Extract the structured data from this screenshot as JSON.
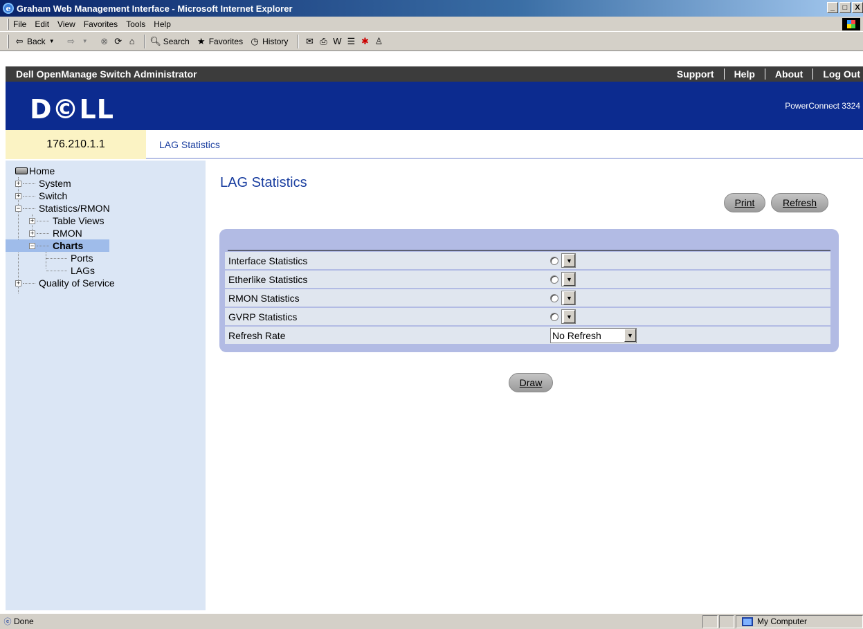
{
  "window": {
    "title": "Graham Web Management Interface - Microsoft Internet Explorer",
    "controls": [
      "_",
      "□",
      "X"
    ]
  },
  "menu": [
    "File",
    "Edit",
    "View",
    "Favorites",
    "Tools",
    "Help"
  ],
  "toolbar": {
    "back": "Back",
    "search": "Search",
    "favorites": "Favorites",
    "history": "History"
  },
  "header": {
    "app_title": "Dell OpenManage Switch Administrator",
    "links": [
      "Support",
      "Help",
      "About",
      "Log Out"
    ],
    "logo": "D©LL",
    "product": "PowerConnect 3324"
  },
  "crumbbar": {
    "ip": "176.210.1.1",
    "breadcrumb": "LAG Statistics"
  },
  "nav": {
    "home": "Home",
    "system": "System",
    "switch": "Switch",
    "stats": "Statistics/RMON",
    "table_views": "Table Views",
    "rmon": "RMON",
    "charts": "Charts",
    "ports": "Ports",
    "lags": "LAGs",
    "qos": "Quality of Service"
  },
  "main": {
    "title": "LAG Statistics",
    "print": "Print",
    "refresh": "Refresh",
    "draw": "Draw",
    "rows": [
      {
        "label": "Interface Statistics"
      },
      {
        "label": "Etherlike Statistics"
      },
      {
        "label": "RMON Statistics"
      },
      {
        "label": "GVRP Statistics"
      }
    ],
    "refresh_rate_label": "Refresh Rate",
    "refresh_rate_value": "No Refresh"
  },
  "status": {
    "left": "Done",
    "zone": "My Computer"
  }
}
